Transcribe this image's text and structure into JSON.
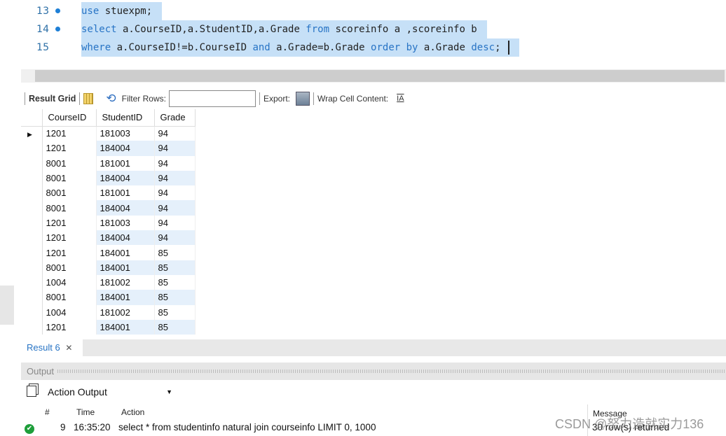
{
  "editor": {
    "lines": [
      {
        "num": "13",
        "parts": [
          {
            "t": "use",
            "kw": true
          },
          {
            "t": " stuexpm;"
          }
        ]
      },
      {
        "num": "14",
        "parts": [
          {
            "t": "select",
            "kw": true
          },
          {
            "t": " a.CourseID,a.StudentID,a.Grade "
          },
          {
            "t": "from",
            "kw": true
          },
          {
            "t": " scoreinfo a ,scoreinfo b"
          }
        ]
      },
      {
        "num": "15",
        "parts": [
          {
            "t": "where",
            "kw": true
          },
          {
            "t": " a.CourseID!=b.CourseID "
          },
          {
            "t": "and",
            "kw": true
          },
          {
            "t": " a.Grade=b.Grade "
          },
          {
            "t": "order by",
            "kw": true
          },
          {
            "t": " a.Grade "
          },
          {
            "t": "desc",
            "kw": true
          },
          {
            "t": ";"
          }
        ]
      }
    ]
  },
  "toolbar": {
    "result_grid": "Result Grid",
    "filter_rows": "Filter Rows:",
    "filter_value": "",
    "export": "Export:",
    "wrap": "Wrap Cell Content:"
  },
  "grid": {
    "columns": [
      "CourseID",
      "StudentID",
      "Grade"
    ],
    "rows": [
      [
        "1201",
        "181003",
        "94"
      ],
      [
        "1201",
        "184004",
        "94"
      ],
      [
        "8001",
        "181001",
        "94"
      ],
      [
        "8001",
        "184004",
        "94"
      ],
      [
        "8001",
        "181001",
        "94"
      ],
      [
        "8001",
        "184004",
        "94"
      ],
      [
        "1201",
        "181003",
        "94"
      ],
      [
        "1201",
        "184004",
        "94"
      ],
      [
        "1201",
        "184001",
        "85"
      ],
      [
        "8001",
        "184001",
        "85"
      ],
      [
        "1004",
        "181002",
        "85"
      ],
      [
        "8001",
        "184001",
        "85"
      ],
      [
        "1004",
        "181002",
        "85"
      ],
      [
        "1201",
        "184001",
        "85"
      ]
    ]
  },
  "result_tab": {
    "label": "Result 6",
    "close": "✕"
  },
  "output": {
    "title": "Output",
    "selector": "Action Output",
    "columns": {
      "num": "#",
      "time": "Time",
      "action": "Action",
      "message": "Message"
    },
    "row": {
      "num": "9",
      "time": "16:35:20",
      "action": "select * from studentinfo natural join courseinfo LIMIT 0, 1000",
      "message": "30 row(s) returned",
      "status": "success"
    }
  },
  "watermark": "CSDN @努力造就实力136",
  "colors": {
    "keyword": "#2874c5",
    "selection": "#c6e0f7",
    "success": "#1e9e3a"
  }
}
